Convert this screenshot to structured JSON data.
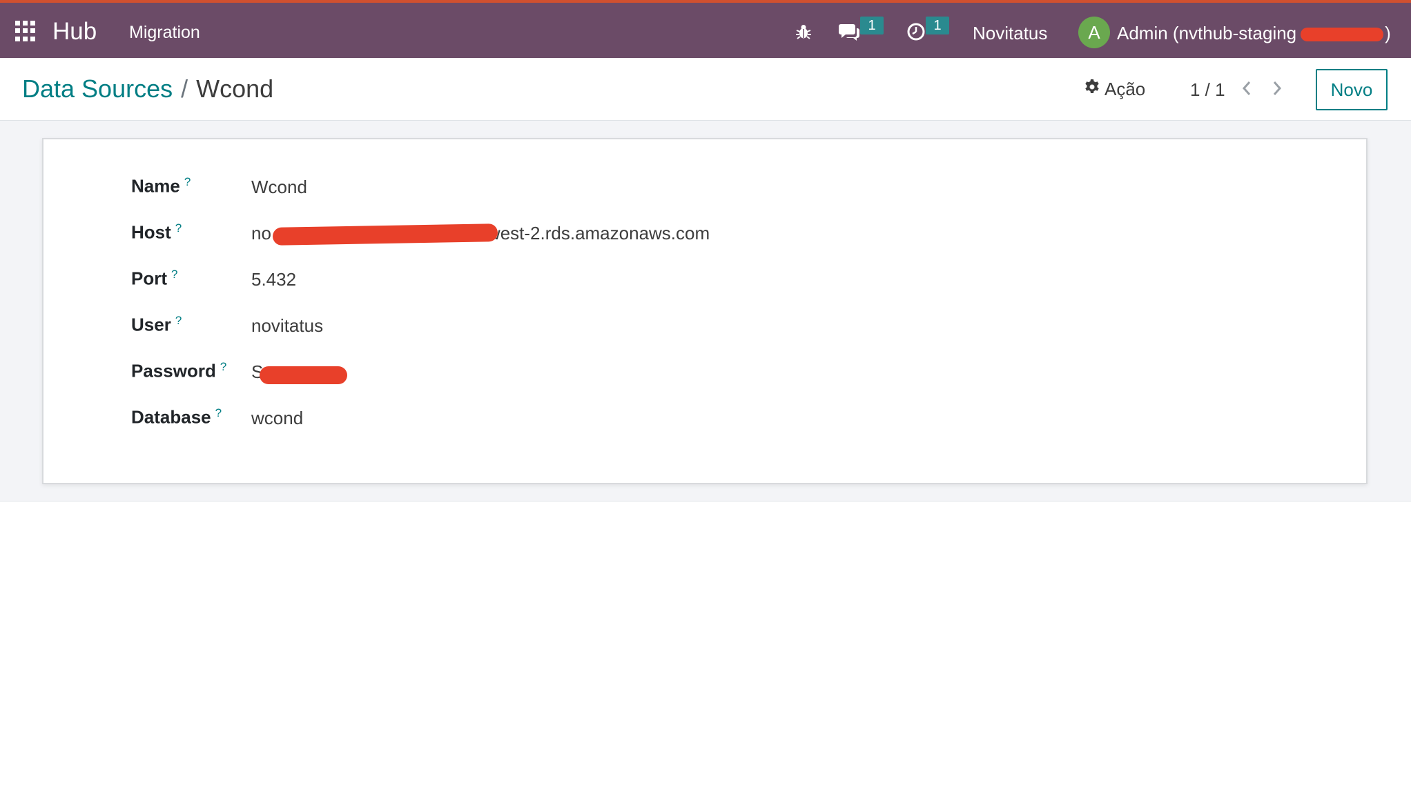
{
  "navbar": {
    "brand": "Hub",
    "menu": [
      "Migration"
    ],
    "chat_badge": "1",
    "activity_badge": "1",
    "company": "Novitatus",
    "avatar_letter": "A",
    "user_name": "Admin (nvthub-staging",
    "user_name_suffix": ")",
    "icons": [
      "apps-icon",
      "bug-icon",
      "chat-icon",
      "clock-icon"
    ],
    "colors": {
      "background": "#6b4b67",
      "top_border": "#d0502f",
      "badge": "#2a8a8f",
      "avatar": "#6aa84f"
    }
  },
  "control_panel": {
    "breadcrumb_parent": "Data Sources",
    "breadcrumb_separator": "/",
    "breadcrumb_current": "Wcond",
    "action_label": "Ação",
    "pager": "1 / 1",
    "new_button": "Novo",
    "accent_color": "#017e84"
  },
  "form": {
    "help_mark": "?",
    "fields": [
      {
        "label": "Name",
        "value": "Wcond"
      },
      {
        "label": "Host",
        "value_prefix": "no",
        "value_suffix": "west-2.rds.amazonaws.com"
      },
      {
        "label": "Port",
        "value": "5.432"
      },
      {
        "label": "User",
        "value": "novitatus"
      },
      {
        "label": "Password",
        "value_prefix": "S"
      },
      {
        "label": "Database",
        "value": "wcond"
      }
    ]
  }
}
